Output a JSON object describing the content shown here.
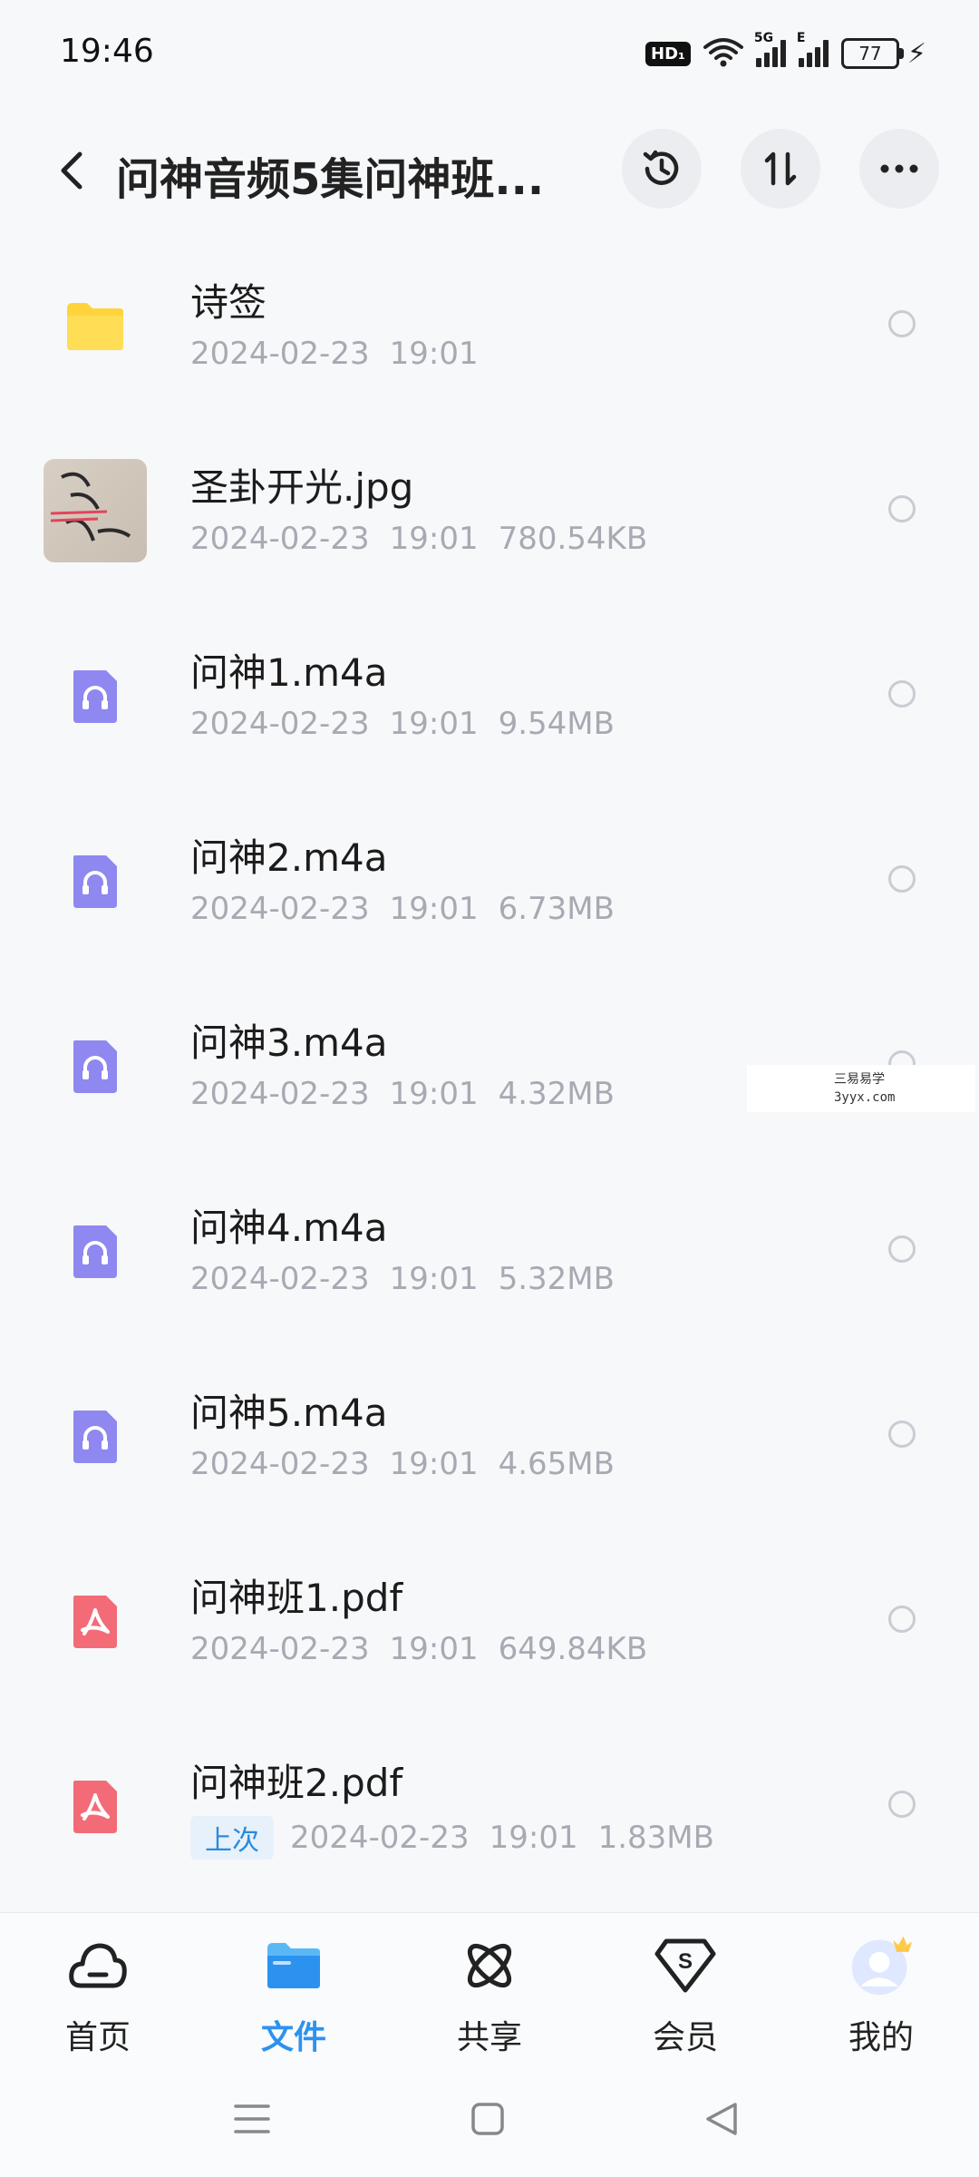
{
  "status_bar": {
    "time": "19:46",
    "hd_badge": "HD₁",
    "network_5g": "5G",
    "network_e": "E",
    "battery": "77"
  },
  "header": {
    "title": "问神音频5集问神班...",
    "icons": [
      "back-icon",
      "history-icon",
      "sort-icon",
      "more-icon"
    ]
  },
  "files": [
    {
      "name": "诗签",
      "date": "2024-02-23",
      "time": "19:01",
      "size": "",
      "type": "folder"
    },
    {
      "name": "圣卦开光.jpg",
      "date": "2024-02-23",
      "time": "19:01",
      "size": "780.54KB",
      "type": "image"
    },
    {
      "name": "问神1.m4a",
      "date": "2024-02-23",
      "time": "19:01",
      "size": "9.54MB",
      "type": "audio"
    },
    {
      "name": "问神2.m4a",
      "date": "2024-02-23",
      "time": "19:01",
      "size": "6.73MB",
      "type": "audio"
    },
    {
      "name": "问神3.m4a",
      "date": "2024-02-23",
      "time": "19:01",
      "size": "4.32MB",
      "type": "audio"
    },
    {
      "name": "问神4.m4a",
      "date": "2024-02-23",
      "time": "19:01",
      "size": "5.32MB",
      "type": "audio"
    },
    {
      "name": "问神5.m4a",
      "date": "2024-02-23",
      "time": "19:01",
      "size": "4.65MB",
      "type": "audio"
    },
    {
      "name": "问神班1.pdf",
      "date": "2024-02-23",
      "time": "19:01",
      "size": "649.84KB",
      "type": "pdf"
    },
    {
      "name": "问神班2.pdf",
      "date": "2024-02-23",
      "time": "19:01",
      "size": "1.83MB",
      "type": "pdf",
      "badge": "上次"
    }
  ],
  "watermark": {
    "line1": "三易易学",
    "line2": "3yyx.com"
  },
  "bottom_nav": {
    "items": [
      {
        "label": "首页",
        "icon": "cloud-home-icon"
      },
      {
        "label": "文件",
        "icon": "folder-icon",
        "active": true
      },
      {
        "label": "共享",
        "icon": "share-atom-icon"
      },
      {
        "label": "会员",
        "icon": "vip-icon"
      },
      {
        "label": "我的",
        "icon": "avatar-icon"
      }
    ]
  },
  "colors": {
    "accent": "#2c92f0",
    "folder": "#ffd43b",
    "audio": "#8e88f0",
    "pdf": "#f26b77",
    "meta_text": "#a7aab2"
  }
}
